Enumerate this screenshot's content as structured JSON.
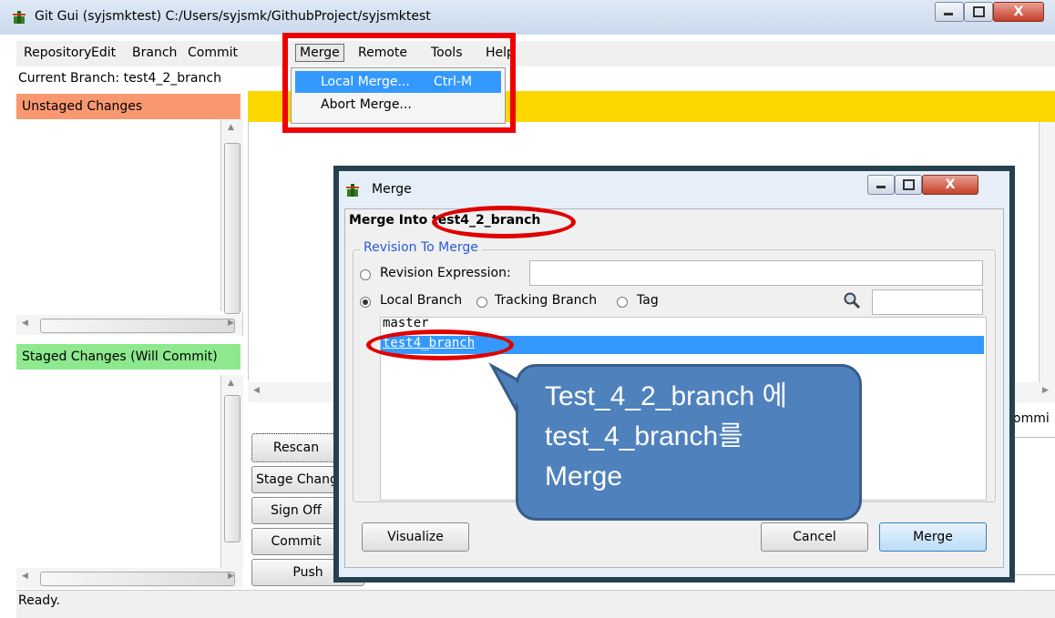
{
  "window": {
    "title": "Git Gui (syjsmktest) C:/Users/syjsmk/GithubProject/syjsmktest",
    "close_glyph": "X"
  },
  "menubar": {
    "items": [
      "Repository",
      "Edit",
      "Branch",
      "Commit",
      "Merge",
      "Remote",
      "Tools",
      "Help"
    ]
  },
  "merge_menu": {
    "items": [
      {
        "label": "Local Merge...",
        "shortcut": "Ctrl-M"
      },
      {
        "label": "Abort Merge...",
        "shortcut": ""
      }
    ]
  },
  "current_branch": "Current Branch: test4_2_branch",
  "panels": {
    "unstaged": "Unstaged Changes",
    "staged": "Staged Changes (Will Commit)"
  },
  "actions": {
    "rescan": "Rescan",
    "stage": "Stage Changed",
    "signoff": "Sign Off",
    "commit": "Commit",
    "push": "Push"
  },
  "right_partial_label": "ommi",
  "status": "Ready.",
  "dialog": {
    "title": "Merge",
    "merge_into": "Merge Into test4_2_branch",
    "group_label": "Revision To Merge",
    "revision_expression_label": "Revision Expression:",
    "revision_expression_value": "",
    "local_branch_label": "Local Branch",
    "tracking_branch_label": "Tracking Branch",
    "tag_label": "Tag",
    "filter_value": "",
    "branches": [
      "master",
      "test4_branch"
    ],
    "selected_branch": "test4_branch",
    "visualize": "Visualize",
    "cancel": "Cancel",
    "merge": "Merge"
  },
  "annotation": {
    "callout": "Test_4_2_branch 에\ntest_4_branch를\nMerge"
  },
  "colors": {
    "unstaged_header": "#f99870",
    "staged_header": "#8ee88e",
    "diff_header": "#ffd700",
    "selection": "#3399ff",
    "highlight_red": "#ee0000",
    "callout_fill": "#4f81bd"
  }
}
